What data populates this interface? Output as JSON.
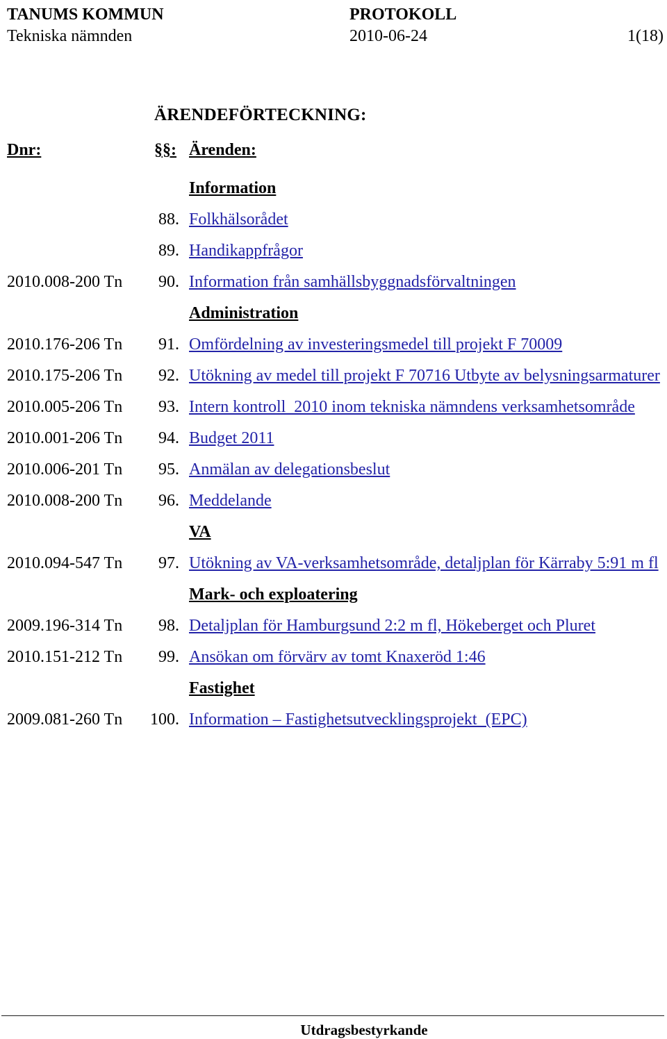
{
  "header": {
    "organization": "TANUMS KOMMUN",
    "document_type": "PROTOKOLL",
    "board": "Tekniska nämnden",
    "date": "2010-06-24",
    "page_number": "1(18)"
  },
  "title": "ÄRENDEFÖRTECKNING:",
  "columns": {
    "dnr": "Dnr:",
    "paragraph": "§§:",
    "matter": "Ärenden:"
  },
  "colors": {
    "link": "#2323a8",
    "text": "#000000",
    "background": "#ffffff"
  },
  "entries": [
    {
      "kind": "section",
      "label": "Information"
    },
    {
      "kind": "item",
      "dnr": "",
      "paragraph": "88.",
      "title": "Folkhälsorådet"
    },
    {
      "kind": "item",
      "dnr": "",
      "paragraph": "89.",
      "title": "Handikappfrågor"
    },
    {
      "kind": "item",
      "dnr": "2010.008-200 Tn",
      "paragraph": "90.",
      "title": "Information från samhällsbyggnadsförvaltningen"
    },
    {
      "kind": "section",
      "label": "Administration"
    },
    {
      "kind": "item",
      "dnr": "2010.176-206 Tn",
      "paragraph": "91.",
      "title": "Omfördelning av investeringsmedel till projekt F 70009"
    },
    {
      "kind": "item",
      "dnr": "2010.175-206 Tn",
      "paragraph": "92.",
      "title": "Utökning av medel till projekt F 70716 Utbyte av belysningsarmaturer"
    },
    {
      "kind": "item",
      "dnr": "2010.005-206 Tn",
      "paragraph": "93.",
      "title": "Intern kontroll  2010 inom tekniska nämndens verksamhetsområde"
    },
    {
      "kind": "item",
      "dnr": "2010.001-206 Tn",
      "paragraph": "94.",
      "title": "Budget 2011"
    },
    {
      "kind": "item",
      "dnr": "2010.006-201 Tn",
      "paragraph": "95.",
      "title": "Anmälan av delegationsbeslut"
    },
    {
      "kind": "item",
      "dnr": "2010.008-200 Tn",
      "paragraph": "96.",
      "title": "Meddelande"
    },
    {
      "kind": "section",
      "label": "VA"
    },
    {
      "kind": "item",
      "dnr": "2010.094-547 Tn",
      "paragraph": "97.",
      "title": "Utökning av VA-verksamhetsområde, detaljplan för Kärraby 5:91 m fl"
    },
    {
      "kind": "section",
      "label": "Mark- och exploatering"
    },
    {
      "kind": "item",
      "dnr": "2009.196-314 Tn",
      "paragraph": "98.",
      "title": "Detaljplan för Hamburgsund 2:2 m fl, Hökeberget och Pluret"
    },
    {
      "kind": "item",
      "dnr": "2010.151-212 Tn",
      "paragraph": "99.",
      "title": "Ansökan om förvärv av tomt Knaxeröd 1:46"
    },
    {
      "kind": "section",
      "label": "Fastighet"
    },
    {
      "kind": "item",
      "dnr": "2009.081-260 Tn",
      "paragraph": "100.",
      "title": "Information – Fastighetsutvecklingsprojekt  (EPC)"
    }
  ],
  "footer": {
    "attestation": "Utdragsbestyrkande"
  }
}
